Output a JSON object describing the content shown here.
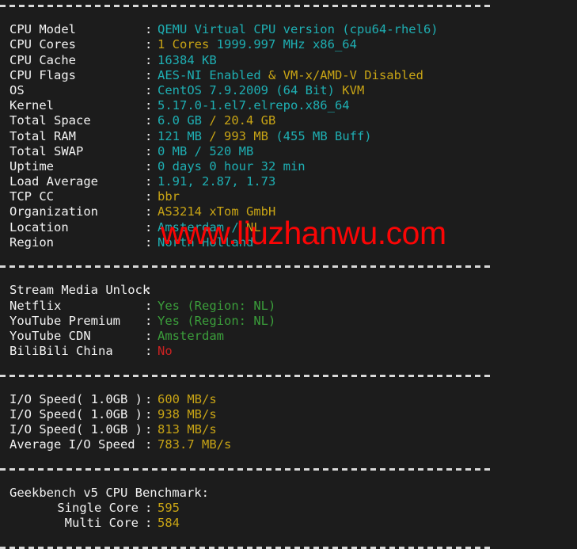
{
  "terminal": {
    "background_color": "#1c1c1c",
    "colors": {
      "label": "#f2f2f2",
      "cyan": "#1eafb3",
      "yellow": "#c8a415",
      "green": "#3b9e3b",
      "red": "#cc2222",
      "watermark": "#fb0505"
    },
    "watermark_text": "www.liuzhanwu.com",
    "sections": [
      {
        "id": "system-info",
        "rows": [
          {
            "label": "CPU Model",
            "segments": [
              {
                "text": "QEMU Virtual CPU version (cpu64-rhel6)",
                "color": "cyan"
              }
            ]
          },
          {
            "label": "CPU Cores",
            "segments": [
              {
                "text": "1 Cores ",
                "color": "yellow"
              },
              {
                "text": "1999.997 MHz x86_64",
                "color": "cyan"
              }
            ]
          },
          {
            "label": "CPU Cache",
            "segments": [
              {
                "text": "16384 KB",
                "color": "cyan"
              }
            ]
          },
          {
            "label": "CPU Flags",
            "segments": [
              {
                "text": "AES-NI Enabled ",
                "color": "cyan"
              },
              {
                "text": "& VM-x/AMD-V Disabled",
                "color": "yellow"
              }
            ]
          },
          {
            "label": "OS",
            "segments": [
              {
                "text": "CentOS 7.9.2009 (64 Bit) ",
                "color": "cyan"
              },
              {
                "text": "KVM",
                "color": "yellow"
              }
            ]
          },
          {
            "label": "Kernel",
            "segments": [
              {
                "text": "5.17.0-1.el7.elrepo.x86_64",
                "color": "cyan"
              }
            ]
          },
          {
            "label": "Total Space",
            "segments": [
              {
                "text": "6.0 GB ",
                "color": "cyan"
              },
              {
                "text": "/ 20.4 GB",
                "color": "yellow"
              }
            ]
          },
          {
            "label": "Total RAM",
            "segments": [
              {
                "text": "121 MB ",
                "color": "cyan"
              },
              {
                "text": "/ 993 MB ",
                "color": "yellow"
              },
              {
                "text": "(455 MB Buff)",
                "color": "cyan"
              }
            ]
          },
          {
            "label": "Total SWAP",
            "segments": [
              {
                "text": "0 MB / 520 MB",
                "color": "cyan"
              }
            ]
          },
          {
            "label": "Uptime",
            "segments": [
              {
                "text": "0 days 0 hour 32 min",
                "color": "cyan"
              }
            ]
          },
          {
            "label": "Load Average",
            "segments": [
              {
                "text": "1.91, 2.87, 1.73",
                "color": "cyan"
              }
            ]
          },
          {
            "label": "TCP CC",
            "segments": [
              {
                "text": "bbr",
                "color": "yellow"
              }
            ]
          },
          {
            "label": "Organization",
            "segments": [
              {
                "text": "AS3214 xTom GmbH",
                "color": "yellow"
              }
            ]
          },
          {
            "label": "Location",
            "segments": [
              {
                "text": "Amsterdam / ",
                "color": "cyan"
              },
              {
                "text": "NL",
                "color": "yellow"
              }
            ]
          },
          {
            "label": "Region",
            "segments": [
              {
                "text": "North Holland",
                "color": "cyan"
              }
            ]
          }
        ]
      },
      {
        "id": "stream-media-unlock",
        "rows": [
          {
            "label": "Stream Media Unlock",
            "segments": []
          },
          {
            "label": "Netflix",
            "segments": [
              {
                "text": "Yes (Region: NL)",
                "color": "green"
              }
            ]
          },
          {
            "label": "YouTube Premium",
            "segments": [
              {
                "text": "Yes (Region: NL)",
                "color": "green"
              }
            ]
          },
          {
            "label": "YouTube CDN",
            "segments": [
              {
                "text": "Amsterdam",
                "color": "green"
              }
            ]
          },
          {
            "label": "BiliBili China",
            "segments": [
              {
                "text": "No",
                "color": "red"
              }
            ]
          }
        ]
      },
      {
        "id": "io-speed",
        "rows": [
          {
            "label": "I/O Speed( 1.0GB )",
            "segments": [
              {
                "text": "600 MB/s",
                "color": "yellow"
              }
            ]
          },
          {
            "label": "I/O Speed( 1.0GB )",
            "segments": [
              {
                "text": "938 MB/s",
                "color": "yellow"
              }
            ]
          },
          {
            "label": "I/O Speed( 1.0GB )",
            "segments": [
              {
                "text": "813 MB/s",
                "color": "yellow"
              }
            ]
          },
          {
            "label": "Average I/O Speed",
            "segments": [
              {
                "text": "783.7 MB/s",
                "color": "yellow"
              }
            ]
          }
        ]
      },
      {
        "id": "geekbench",
        "heading": "Geekbench v5 CPU Benchmark:",
        "rows": [
          {
            "label": "Single Core",
            "align": "right",
            "segments": [
              {
                "text": "595",
                "color": "yellow"
              }
            ]
          },
          {
            "label": "Multi Core",
            "align": "right",
            "segments": [
              {
                "text": "584",
                "color": "yellow"
              }
            ]
          }
        ]
      }
    ]
  }
}
